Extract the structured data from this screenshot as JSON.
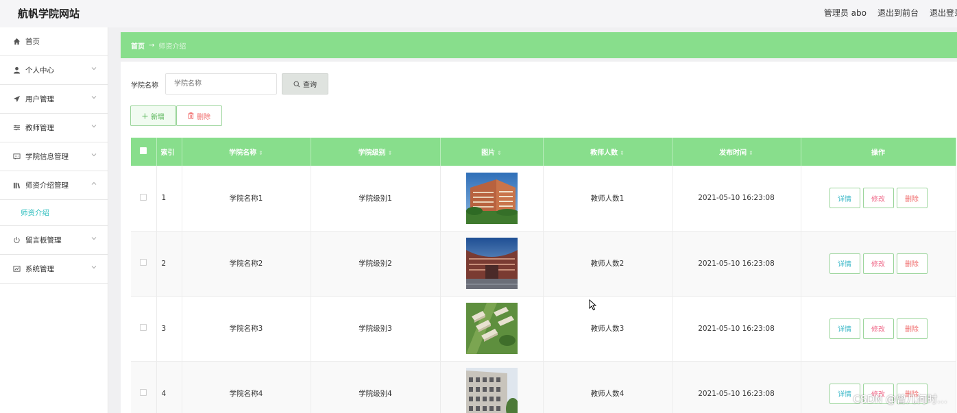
{
  "header": {
    "site_title": "航帆学院网站",
    "admin_label": "管理员 abo",
    "back_to_front": "退出到前台",
    "logout": "退出登录"
  },
  "sidebar": {
    "items": [
      {
        "label": "首页",
        "icon": "home-icon"
      },
      {
        "label": "个人中心",
        "icon": "user-icon"
      },
      {
        "label": "用户管理",
        "icon": "send-icon"
      },
      {
        "label": "教师管理",
        "icon": "sliders-icon"
      },
      {
        "label": "学院信息管理",
        "icon": "chat-icon"
      },
      {
        "label": "师资介绍管理",
        "icon": "books-icon",
        "expanded": true
      },
      {
        "label": "留言板管理",
        "icon": "power-icon"
      },
      {
        "label": "系统管理",
        "icon": "chart-icon"
      }
    ],
    "sub_item": "师资介绍"
  },
  "breadcrumb": {
    "home": "首页",
    "arrow": "→",
    "current": "师资介绍"
  },
  "search": {
    "label": "学院名称",
    "placeholder": "学院名称",
    "button": "查询"
  },
  "actions": {
    "add": "新增",
    "delete": "删除"
  },
  "table": {
    "columns": [
      "索引",
      "学院名称",
      "学院级别",
      "图片",
      "教师人数",
      "发布时间",
      "操作"
    ],
    "rows": [
      {
        "index": "1",
        "name": "学院名称1",
        "level": "学院级别1",
        "teachers": "教师人数1",
        "time": "2021-05-10 16:23:08"
      },
      {
        "index": "2",
        "name": "学院名称2",
        "level": "学院级别2",
        "teachers": "教师人数2",
        "time": "2021-05-10 16:23:08"
      },
      {
        "index": "3",
        "name": "学院名称3",
        "level": "学院级别3",
        "teachers": "教师人数3",
        "time": "2021-05-10 16:23:08"
      },
      {
        "index": "4",
        "name": "学院名称4",
        "level": "学院级别4",
        "teachers": "教师人数4",
        "time": "2021-05-10 16:23:08"
      }
    ],
    "op_labels": {
      "detail": "详情",
      "edit": "修改",
      "delete": "删除"
    }
  },
  "watermark": "CSDN @曾几何时…",
  "colors": {
    "accent_green": "#88de8c",
    "detail_color": "#3cb8c8",
    "delete_color": "#f06b6b"
  }
}
